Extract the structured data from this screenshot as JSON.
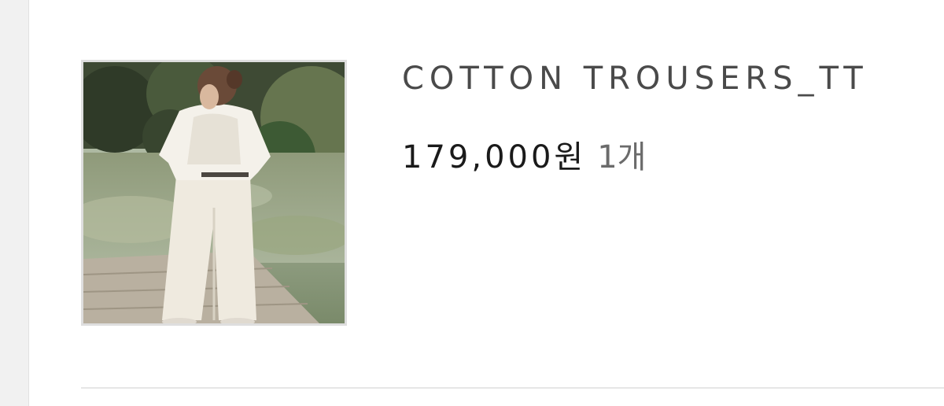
{
  "order_item": {
    "name": "COTTON TROUSERS_TT",
    "price": "179,000원",
    "quantity": "1개",
    "image": {
      "icon": "product-photo"
    }
  }
}
